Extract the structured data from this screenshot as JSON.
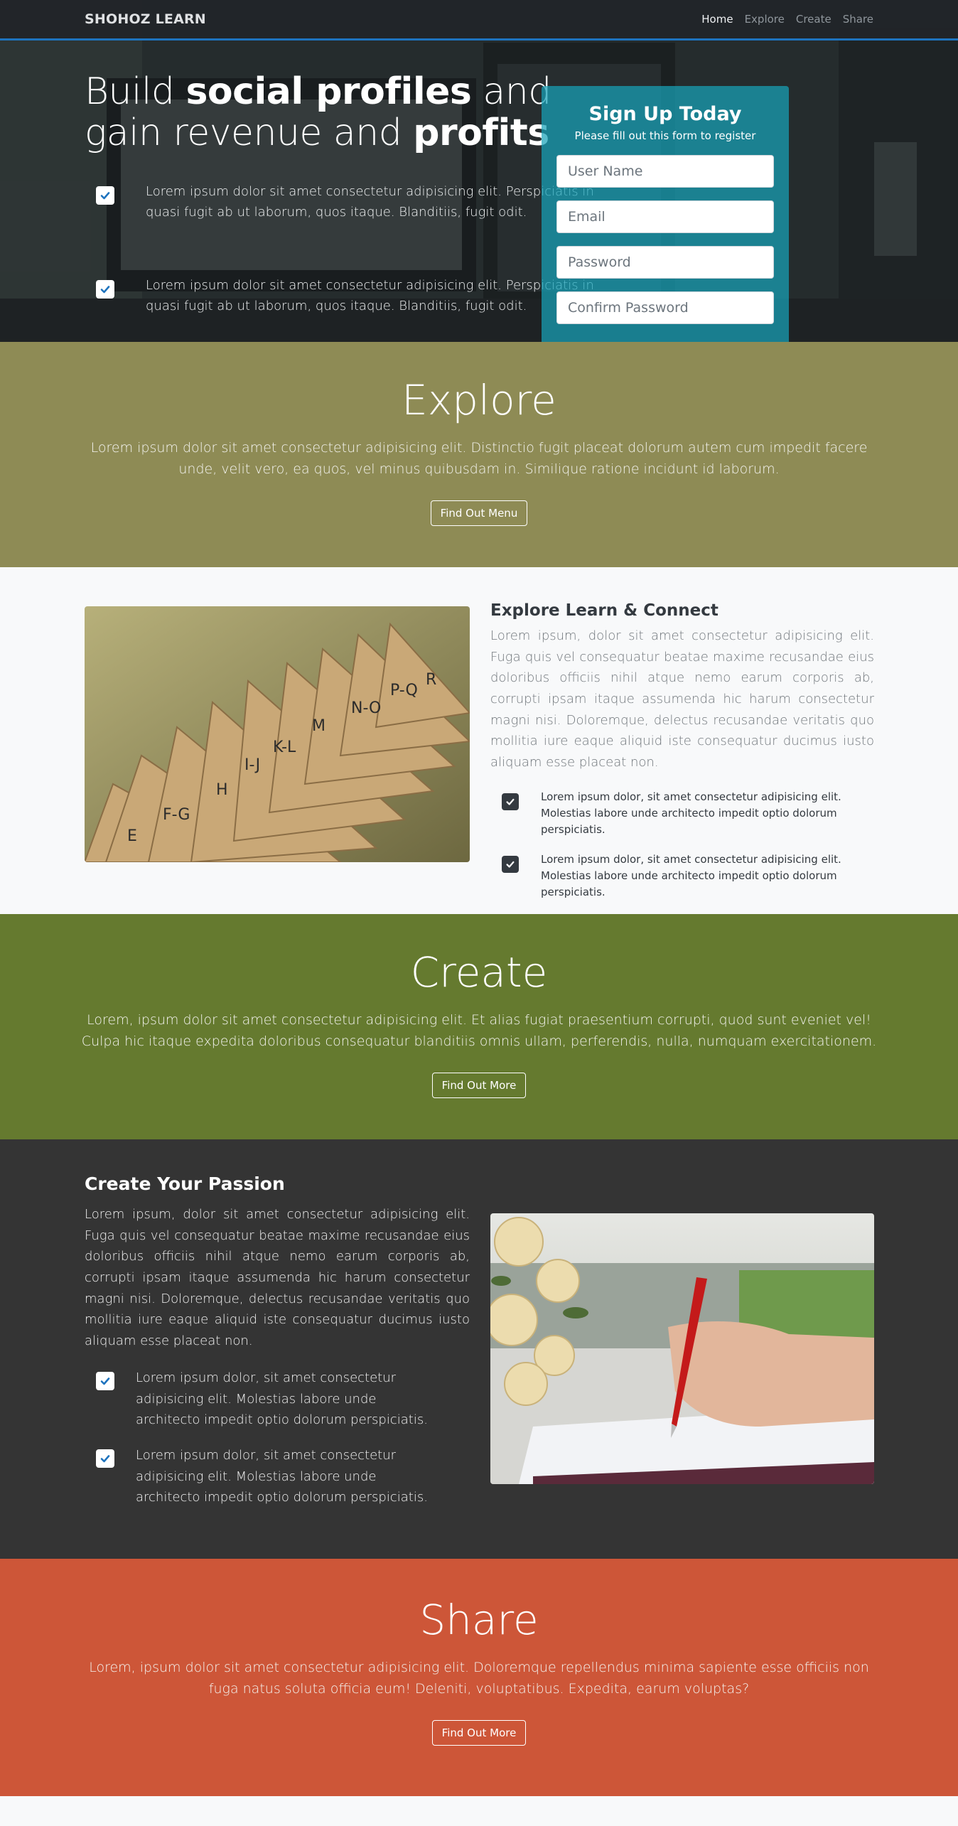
{
  "nav": {
    "brand": "SHOHOZ LEARN",
    "links": [
      "Home",
      "Explore",
      "Create",
      "Share"
    ]
  },
  "hero": {
    "title_part1": "Build ",
    "title_bold1": "social profiles",
    "title_part2": " and gain revenue and ",
    "title_bold2": "profits",
    "items": [
      "Lorem ipsum dolor sit amet consectetur adipisicing elit. Perspiciatis in quasi fugit ab ut laborum, quos itaque. Blanditiis, fugit odit.",
      "Lorem ipsum dolor sit amet consectetur adipisicing elit. Perspiciatis in quasi fugit ab ut laborum, quos itaque. Blanditiis, fugit odit."
    ]
  },
  "signup": {
    "title": "Sign Up Today",
    "subtitle": "Please fill out this form to register",
    "username_placeholder": "User Name",
    "email_placeholder": "Email",
    "password_placeholder": "Password",
    "confirm_placeholder": "Confirm Password"
  },
  "explore": {
    "heading": "Explore",
    "text": "Lorem ipsum dolor sit amet consectetur adipisicing elit. Distinctio fugit placeat dolorum autem cum impedit facere unde, velit vero, ea quos, vel minus quibusdam in. Similique ratione incidunt id laborum.",
    "button": "Find Out Menu"
  },
  "learn": {
    "heading": "Explore Learn & Connect",
    "text": "Lorem ipsum, dolor sit amet consectetur adipisicing elit. Fuga quis vel consequatur beatae maxime recusandae eius doloribus officiis nihil atque nemo earum corporis ab, corrupti ipsam itaque assumenda hic harum consectetur magni nisi. Doloremque, delectus recusandae veritatis quo mollitia iure eaque aliquid iste consequatur ducimus iusto aliquam esse placeat non.",
    "items": [
      "Lorem ipsum dolor, sit amet consectetur adipisicing elit. Molestias labore unde architecto impedit optio dolorum perspiciatis.",
      "Lorem ipsum dolor, sit amet consectetur adipisicing elit. Molestias labore unde architecto impedit optio dolorum perspiciatis."
    ],
    "folder_labels": [
      "E",
      "F-G",
      "H",
      "I-J",
      "K-L",
      "M",
      "N-O",
      "P-Q",
      "R"
    ]
  },
  "create": {
    "heading": "Create",
    "text": "Lorem, ipsum dolor sit amet consectetur adipisicing elit. Et alias fugiat praesentium corrupti, quod sunt eveniet vel! Culpa hic itaque expedita doloribus consequatur blanditiis omnis ullam, perferendis, nulla, numquam exercitationem.",
    "button": "Find Out More"
  },
  "passion": {
    "heading": "Create Your Passion",
    "text": "Lorem ipsum, dolor sit amet consectetur adipisicing elit. Fuga quis vel consequatur beatae maxime recusandae eius doloribus officiis nihil atque nemo earum corporis ab, corrupti ipsam itaque assumenda hic harum consectetur magni nisi. Doloremque, delectus recusandae veritatis quo mollitia iure eaque aliquid iste consequatur ducimus iusto aliquam esse placeat non.",
    "items": [
      "Lorem ipsum dolor, sit amet consectetur adipisicing elit. Molestias labore unde architecto impedit optio dolorum perspiciatis.",
      "Lorem ipsum dolor, sit amet consectetur adipisicing elit. Molestias labore unde architecto impedit optio dolorum perspiciatis."
    ]
  },
  "share": {
    "heading": "Share",
    "text": "Lorem, ipsum dolor sit amet consectetur adipisicing elit. Doloremque repellendus minima sapiente esse officiis non fuga natus soluta officia eum! Deleniti, voluptatibus. Expedita, earum voluptas?",
    "button": "Find Out More"
  },
  "colors": {
    "nav_bg": "#212529",
    "nav_border": "#1e73be",
    "signup_bg": "#17a2b8",
    "explore_bg": "#8e8b55",
    "create_bg": "#657a2f",
    "passion_bg": "#343434",
    "share_bg": "#cd5638",
    "check_blue": "#1e73be"
  },
  "icons": {
    "check": "check-square-icon"
  }
}
